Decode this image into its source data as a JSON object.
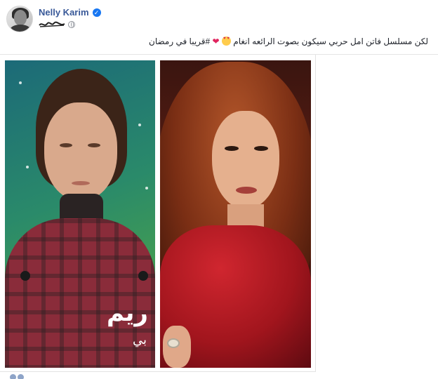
{
  "post": {
    "author_name": "Nelly Karim",
    "verified": true,
    "privacy_icon": "globe-icon",
    "caption_text": "لكن مسلسل فاتن امل حربي سيكون بصوت الرائعه انغام",
    "caption_hashtag": "#قريبا في رمضان",
    "caption_emojis": [
      "heart-eyes-emoji",
      "red-heart-emoji"
    ],
    "photo_left": {
      "overlay_title": "ريم",
      "overlay_subtitle": "بي"
    }
  },
  "colors": {
    "name": "#385898",
    "verified": "#1877f2",
    "heart": "#e0245e"
  }
}
